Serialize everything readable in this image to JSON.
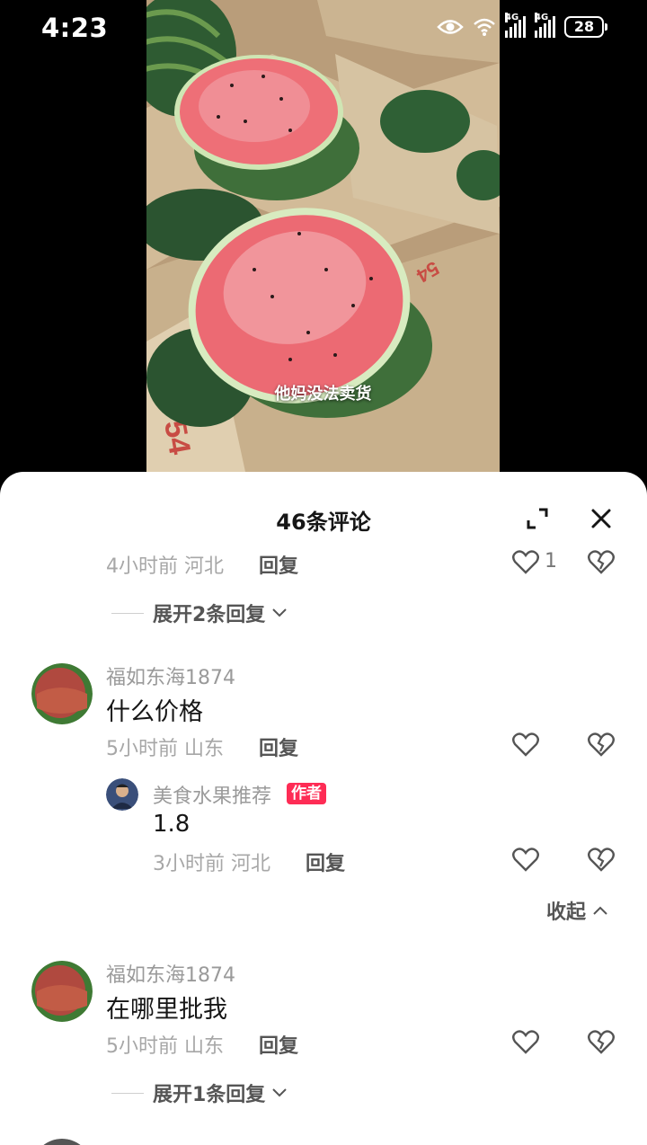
{
  "status_bar": {
    "time": "4:23",
    "network_1": "4G",
    "network_2": "4G",
    "battery": "28"
  },
  "video": {
    "caption": "他妈没法卖货"
  },
  "comments_panel": {
    "title": "46条评论",
    "reply_label": "回复",
    "first_partial": {
      "time_location": "4小时前 河北",
      "likes": "1",
      "expand_replies": "展开2条回复"
    },
    "comments": [
      {
        "username": "福如东海1874",
        "text": "什么价格",
        "time_location": "5小时前 山东",
        "reply": {
          "username": "美食水果推荐",
          "badge": "作者",
          "text": "1.8",
          "time_location": "3小时前 河北"
        },
        "collapse_label": "收起"
      },
      {
        "username": "福如东海1874",
        "text": "在哪里批我",
        "time_location": "5小时前 山东",
        "expand_replies": "展开1条回复"
      }
    ]
  }
}
